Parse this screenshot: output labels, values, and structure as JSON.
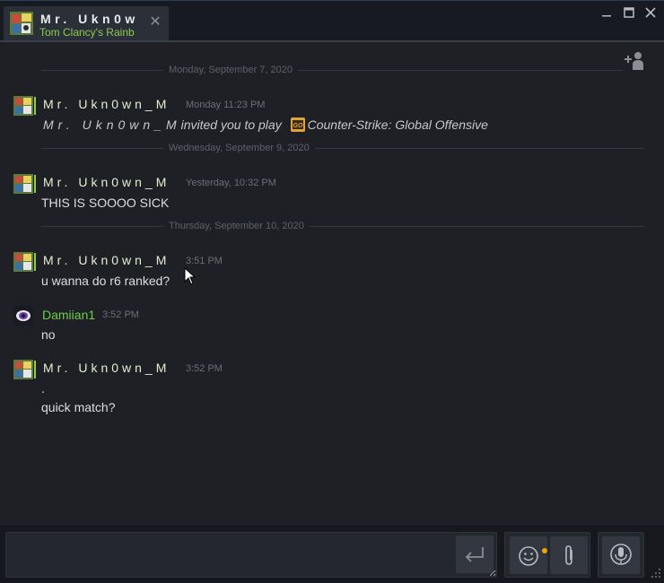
{
  "tab": {
    "name": "Mr. Ukn0w",
    "game": "Tom Clancy's Rainb",
    "close": "✕"
  },
  "window": {
    "minimize": "—",
    "maximize": "☐",
    "close": "✕"
  },
  "dividers": [
    "Monday, September 7, 2020",
    "Wednesday, September 9, 2020",
    "Thursday, September 10, 2020"
  ],
  "messages": [
    {
      "sender": "Mr. Ukn0wn_M",
      "time": "Monday 11:23 PM",
      "invite": {
        "actor": "Mr. Ukn0wn_M",
        "text": "invited you to play",
        "game": "Counter-Strike: Global Offensive",
        "game_icon": "csgo-icon"
      }
    },
    {
      "sender": "Mr. Ukn0wn_M",
      "time": "Yesterday, 10:32 PM",
      "lines": [
        "THIS IS SOOOO SICK"
      ]
    },
    {
      "sender": "Mr. Ukn0wn_M",
      "time": "3:51 PM",
      "lines": [
        "u wanna do r6 ranked?"
      ]
    },
    {
      "sender": "Damiian1",
      "time": "3:52 PM",
      "lines": [
        "no"
      ]
    },
    {
      "sender": "Mr. Ukn0wn_M",
      "time": "3:52 PM",
      "lines": [
        ".",
        "quick match?"
      ]
    }
  ],
  "input": {
    "value": "",
    "placeholder": ""
  },
  "icons": {
    "invite": "add-friend-icon",
    "send": "enter-arrow-icon",
    "emoji": "smiley-icon",
    "attach": "paperclip-icon",
    "voice": "microphone-icon"
  },
  "colors": {
    "background": "#1e2025",
    "titlebar": "#171a21",
    "friend_name": "#6dcf4a",
    "self_name": "#e2f0cf",
    "in_game_green": "#8fcc4f",
    "notification_dot": "#f0a500"
  }
}
